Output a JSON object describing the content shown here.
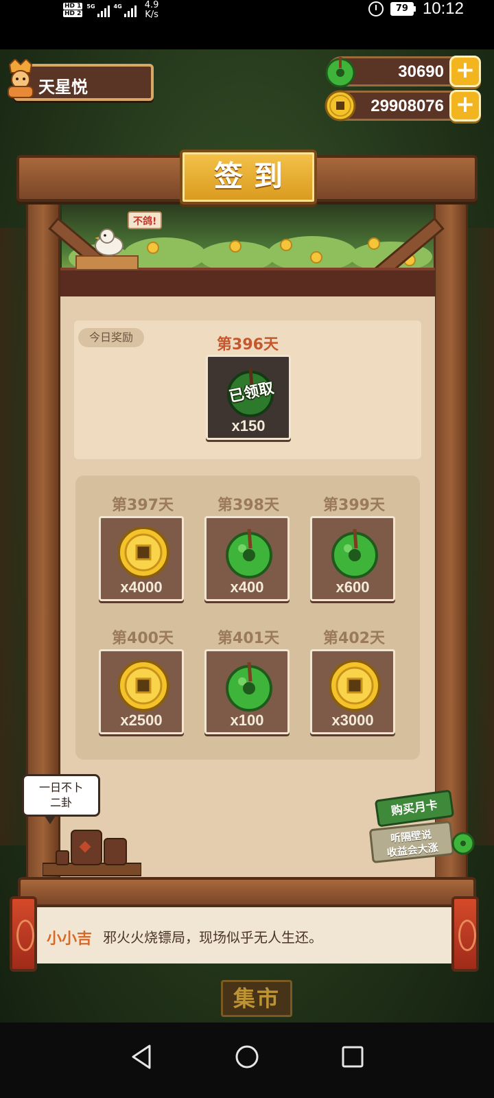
{
  "status_bar": {
    "sim1_label": "HD 1",
    "sim2_label": "HD 2",
    "sim1_network": "5G",
    "sim2_network": "4G",
    "net_speed_value": "4.9",
    "net_speed_unit": "K/s",
    "battery": "79",
    "time": "10:12"
  },
  "player": {
    "name": "天星悦"
  },
  "currencies": {
    "jade": "30690",
    "coins": "29908076"
  },
  "signin": {
    "title": "签到",
    "sign_text": "不鸽!",
    "today_tag": "今日奖励",
    "today": {
      "day_label": "第396天",
      "item": "jade-icon",
      "quantity": "x150",
      "status": "已领取"
    },
    "upcoming": [
      {
        "day_label": "第397天",
        "item": "coin-icon",
        "quantity": "x4000"
      },
      {
        "day_label": "第398天",
        "item": "jade-icon",
        "quantity": "x400"
      },
      {
        "day_label": "第399天",
        "item": "jade-icon",
        "quantity": "x600"
      },
      {
        "day_label": "第400天",
        "item": "coin-icon",
        "quantity": "x2500"
      },
      {
        "day_label": "第401天",
        "item": "jade-icon",
        "quantity": "x100"
      },
      {
        "day_label": "第402天",
        "item": "coin-icon",
        "quantity": "x3000"
      }
    ]
  },
  "shopkeeper_bubble": {
    "line1": "一日不卜",
    "line2": "二卦"
  },
  "month_card": {
    "title": "购买月卡",
    "subtitle_line1": "听隔壁说",
    "subtitle_line2": "收益会大涨"
  },
  "news": {
    "speaker": "小小吉",
    "text": "邪火火烧镖局，现场似乎无人生还。"
  },
  "market_button": "集市",
  "colors": {
    "wood": "#7a4628",
    "gold": "#f2b520",
    "jade_green": "#3eb43a",
    "panel": "#e3cdae",
    "day_highlight": "#c5572e"
  }
}
